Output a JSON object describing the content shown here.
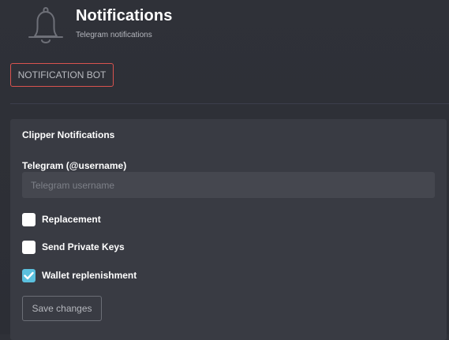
{
  "header": {
    "icon": "bell-icon",
    "title": "Notifications",
    "subtitle": "Telegram notifications"
  },
  "tabs": {
    "bot_label": "NOTIFICATION BOT",
    "active_border_color": "#d9534f"
  },
  "card": {
    "title": "Clipper Notifications",
    "telegram": {
      "label": "Telegram (@username)",
      "placeholder": "Telegram username",
      "value": ""
    },
    "options": [
      {
        "label": "Replacement",
        "checked": false
      },
      {
        "label": "Send Private Keys",
        "checked": false
      },
      {
        "label": "Wallet replenishment",
        "checked": true
      }
    ],
    "save_label": "Save changes"
  },
  "colors": {
    "background": "#2f3138",
    "card": "#393b43",
    "input": "#45474f",
    "checkbox_checked": "#5bc0de",
    "accent_red": "#d9534f"
  }
}
